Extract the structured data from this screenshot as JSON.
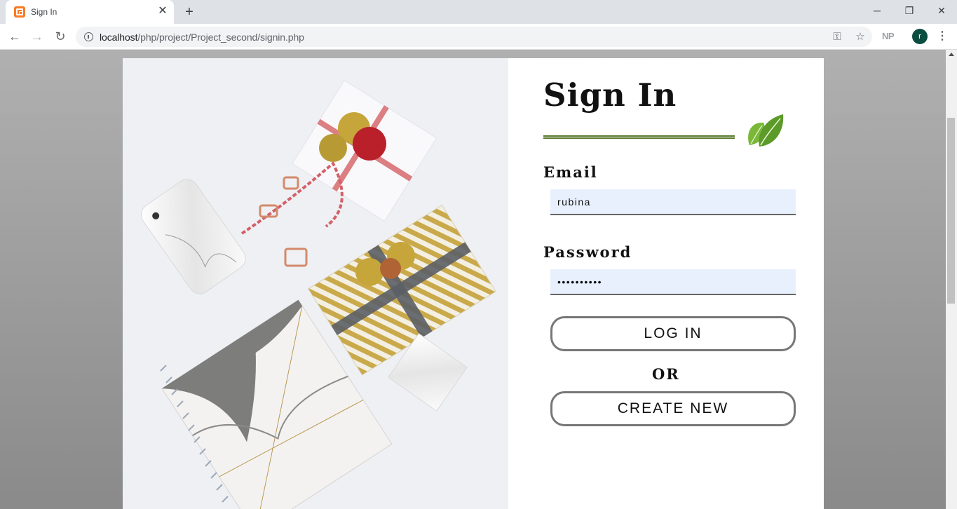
{
  "browser": {
    "tab_title": "Sign In",
    "tab_close": "✕",
    "new_tab": "+",
    "url_host": "localhost",
    "url_path": "/php/project/Project_second/signin.php",
    "extension_label": "NP",
    "avatar_initial": "r",
    "window_controls": {
      "minimize": "─",
      "restore": "❐",
      "close": "✕"
    },
    "nav": {
      "back": "←",
      "forward": "→",
      "reload": "↻",
      "key": "⚿",
      "star": "☆",
      "menu": "⋮"
    }
  },
  "signin": {
    "title": "Sign In",
    "email_label": "Email",
    "email_value": "rubina",
    "password_label": "Password",
    "password_value": "passwordxx",
    "login_button": "LOG IN",
    "or_text": "OR",
    "create_button": "CREATE NEW"
  },
  "colors": {
    "divider": "#5a7a2e",
    "input_bg": "#e8f0fe",
    "button_border": "#777777",
    "leaf_green": "#6aa52c"
  }
}
